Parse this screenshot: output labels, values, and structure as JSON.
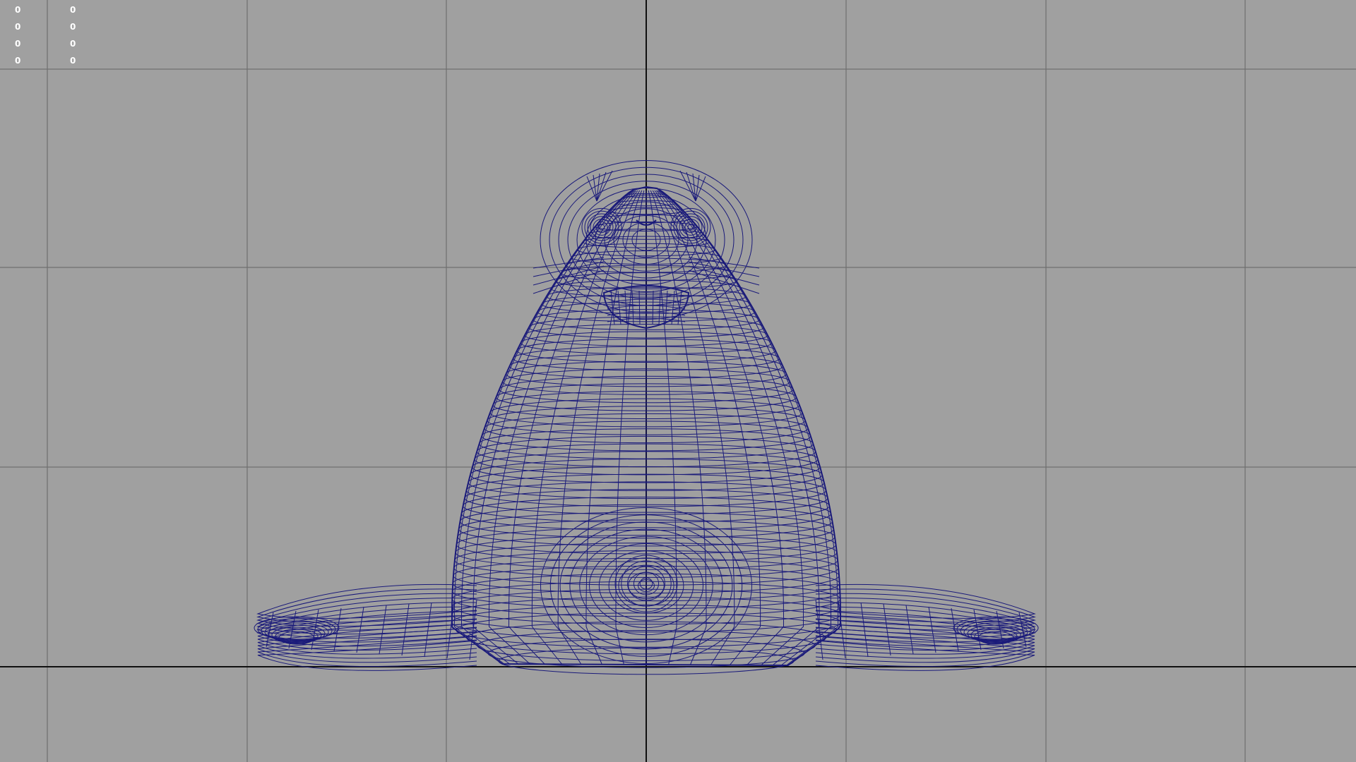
{
  "viewport": {
    "background_color": "#a0a0a0",
    "grid_color": "#6f6f6f",
    "axis_color": "#111111",
    "wireframe_color": "#1a1a7a",
    "model_subject": "seal",
    "display_mode": "wireframe"
  },
  "heads_up_display": {
    "rows": [
      {
        "left": "0",
        "right": "0"
      },
      {
        "left": "0",
        "right": "0"
      },
      {
        "left": "0",
        "right": "0"
      },
      {
        "left": "0",
        "right": "0"
      }
    ]
  }
}
